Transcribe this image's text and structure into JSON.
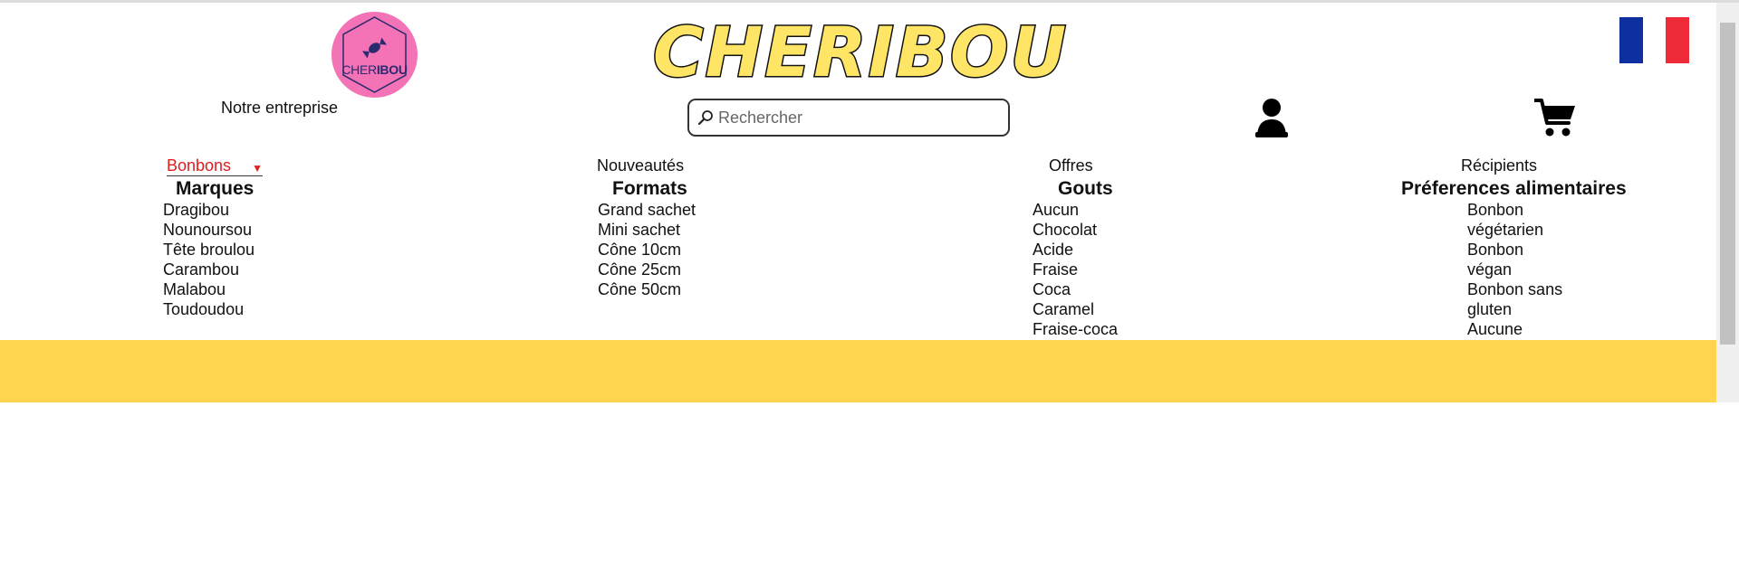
{
  "header": {
    "logo": {
      "text_light": "CHER",
      "text_bold": "IBOU"
    },
    "brand_title": "CHERIBOU",
    "about_link": "Notre entreprise",
    "search": {
      "placeholder": "Rechercher",
      "value": ""
    },
    "icons": {
      "search": "search-icon",
      "user": "user-icon",
      "cart": "cart-icon",
      "language": "flag-fr-icon"
    },
    "flag_colors": [
      "#0d2fa0",
      "#ffffff",
      "#ef2b3a"
    ]
  },
  "nav": {
    "items": [
      {
        "label": "Bonbons",
        "active": true
      },
      {
        "label": "Nouveautés"
      },
      {
        "label": "Offres"
      },
      {
        "label": "Récipients"
      }
    ]
  },
  "dropdown": {
    "columns": [
      {
        "heading": "Marques",
        "items": [
          "Dragibou",
          "Nounoursou",
          "Tête broulou",
          "Carambou",
          "Malabou",
          "Toudoudou"
        ]
      },
      {
        "heading": "Formats",
        "items": [
          "Grand sachet",
          "Mini sachet",
          "Cône 10cm",
          "Cône 25cm",
          "Cône 50cm"
        ]
      },
      {
        "heading": "Gouts",
        "items": [
          "Aucun",
          "Chocolat",
          "Acide",
          "Fraise",
          "Coca",
          "Caramel",
          "Fraise-coca"
        ]
      },
      {
        "heading": "Préferences alimentaires",
        "items": [
          "Bonbon",
          "végétarien",
          "Bonbon",
          "végan",
          "Bonbon sans",
          "gluten",
          "Aucune"
        ]
      }
    ]
  },
  "colors": {
    "brand_yellow": "#ffe566",
    "band": "#ffd54f",
    "logo_pink": "#f472b6",
    "active_nav": "#e11d1d"
  }
}
